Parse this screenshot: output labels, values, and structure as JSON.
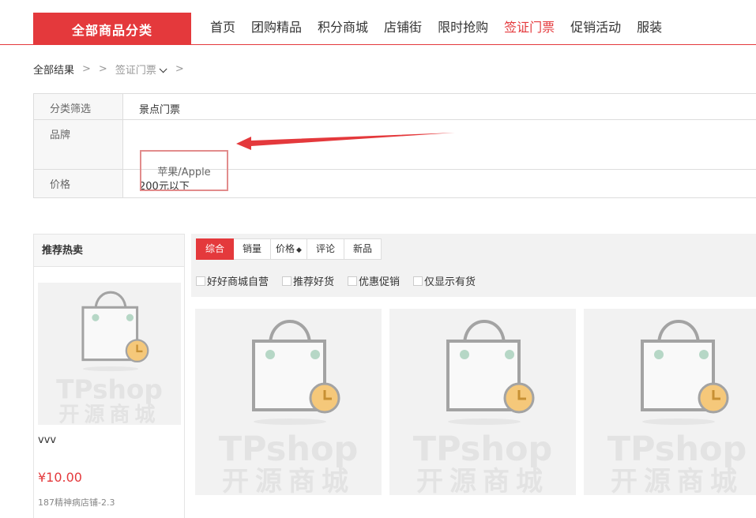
{
  "nav": {
    "all_categories": "全部商品分类",
    "items": [
      "首页",
      "团购精品",
      "积分商城",
      "店铺街",
      "限时抢购",
      "签证门票",
      "促销活动",
      "服装"
    ],
    "active_index": 5
  },
  "breadcrumb": {
    "root": "全部结果",
    "category": "签证门票"
  },
  "filters": {
    "category_label": "分类筛选",
    "category_value": "景点门票",
    "brand_label": "品牌",
    "brand_value": "苹果/Apple",
    "price_label": "价格",
    "price_value": "200元以下"
  },
  "sidebar": {
    "title": "推荐热卖",
    "product": {
      "name": "vvv",
      "price": "¥10.00",
      "shop": "187精神病店铺-2.3"
    }
  },
  "sort": {
    "tabs": [
      "综合",
      "销量",
      "价格",
      "评论",
      "新品"
    ],
    "active_index": 0,
    "price_arrow": "◆"
  },
  "checkboxes": [
    "好好商城自营",
    "推荐好货",
    "优惠促销",
    "仅显示有货"
  ],
  "placeholder": {
    "brand": "TPshop",
    "subtitle": "开源商城"
  },
  "colors": {
    "accent": "#e4393c",
    "annotation_arrow": "#e4393c",
    "clock": "#f5c87a"
  }
}
